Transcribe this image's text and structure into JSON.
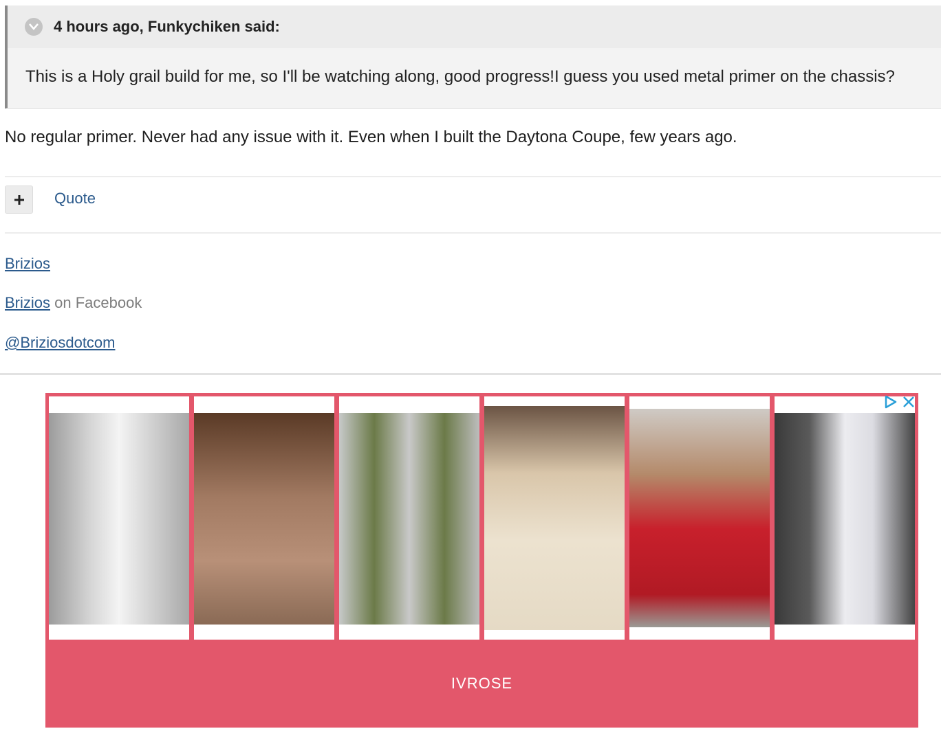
{
  "quote": {
    "citation": "4 hours ago, Funkychiken said:",
    "body": "This is a Holy grail build for me, so I'll be watching along, good progress!I guess you used metal primer on the chassis?"
  },
  "post": {
    "text": "No regular primer. Never had any issue with it. Even when I built the Daytona Coupe, few years ago."
  },
  "actions": {
    "plus_label": "+",
    "quote_label": "Quote"
  },
  "signature": {
    "link1": "Brizios",
    "link2": "Brizios",
    "link2_suffix": "on Facebook",
    "link3": "@Briziosdotcom"
  },
  "ad": {
    "brand_label": "IVROSE",
    "products": [
      {
        "icon": "white-blazer-dress-photo",
        "color": "#f2f2f2"
      },
      {
        "icon": "sequin-slip-dress-photo",
        "color": "#a27a62"
      },
      {
        "icon": "olive-shirt-dress-photo",
        "color": "#6b7a48"
      },
      {
        "icon": "lace-romper-photo",
        "color": "#ece2cf"
      },
      {
        "icon": "red-backless-dress-photo",
        "color": "#c8202c"
      },
      {
        "icon": "white-tracksuit-photo",
        "color": "#ececf0"
      }
    ],
    "accent": "#e3576b"
  }
}
